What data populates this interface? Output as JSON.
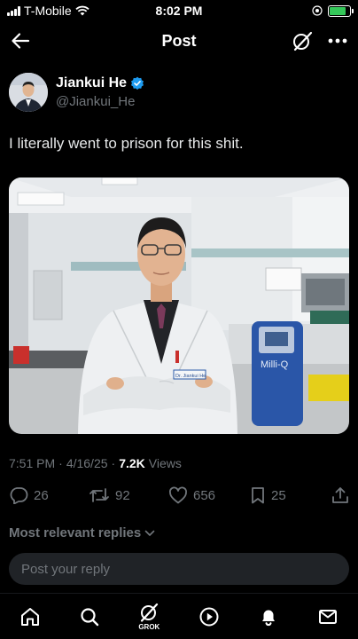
{
  "status_bar": {
    "carrier": "T-Mobile",
    "time": "8:02 PM"
  },
  "nav": {
    "title": "Post",
    "back_icon": "arrow-left-icon",
    "grok_icon": "grok-icon",
    "more_icon": "more-horizontal-icon"
  },
  "author": {
    "name": "Jiankui He",
    "handle": "@Jiankui_He",
    "verified": true,
    "badge_color": "#1d9bf0"
  },
  "tweet": {
    "text": "I literally went to prison for this shit.",
    "time": "7:51 PM",
    "date": "4/16/25",
    "views_count": "7.2K",
    "views_label": "Views"
  },
  "media": {
    "badge_text": "Dr. Jiankui He",
    "device_label": "Milli-Q"
  },
  "actions": {
    "replies": "26",
    "reposts": "92",
    "likes": "656",
    "bookmarks": "25"
  },
  "replies_filter": {
    "label": "Most relevant replies"
  },
  "reply_input": {
    "placeholder": "Post your reply"
  },
  "tab_bar": {
    "grok_label": "GROK"
  },
  "colors": {
    "background": "#000000",
    "text": "#e7e9ea",
    "muted": "#71767b",
    "accent": "#1d9bf0",
    "battery": "#34c759"
  }
}
